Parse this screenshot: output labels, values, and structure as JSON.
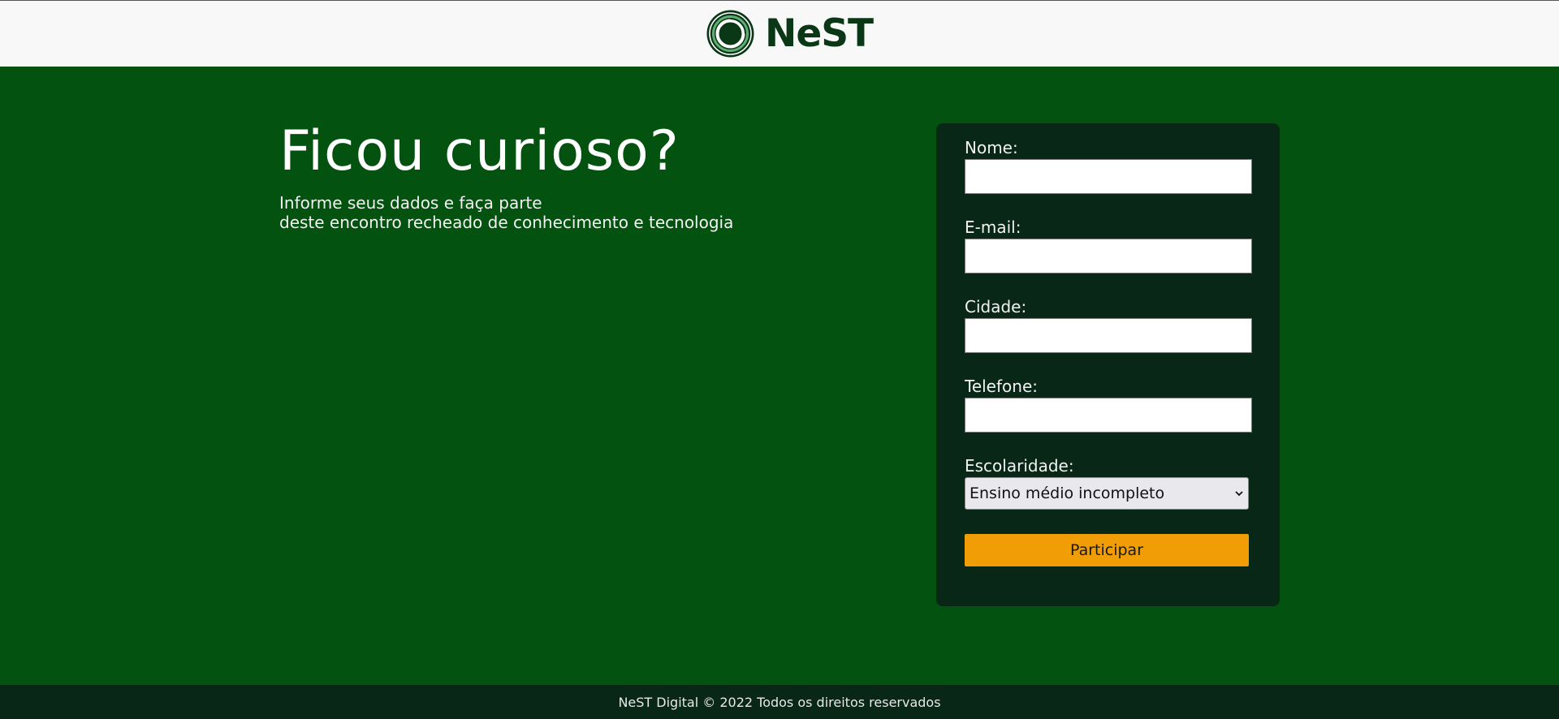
{
  "header": {
    "brand_name": "NeST",
    "logo_icon": "nest-ring-logo-icon"
  },
  "hero": {
    "title": "Ficou curioso?",
    "subtitle_line1": "Informe seus dados e faça parte",
    "subtitle_line2": "deste encontro recheado de conhecimento e tecnologia"
  },
  "form": {
    "fields": [
      {
        "label": "Nome:",
        "value": "",
        "placeholder": ""
      },
      {
        "label": "E-mail:",
        "value": "",
        "placeholder": ""
      },
      {
        "label": "Cidade:",
        "value": "",
        "placeholder": ""
      },
      {
        "label": "Telefone:",
        "value": "",
        "placeholder": ""
      }
    ],
    "education": {
      "label": "Escolaridade:",
      "selected": "Ensino médio incompleto",
      "icon": "chevron-down-icon"
    },
    "submit_label": "Participar"
  },
  "footer": {
    "text": "NeST Digital © 2022 Todos os direitos reservados"
  },
  "colors": {
    "header_bg": "#f8f8f8",
    "main_bg": "#03520f",
    "card_bg": "#082717",
    "footer_bg": "#082717",
    "brand_text": "#0a3716",
    "accent_button": "#f09d06"
  }
}
